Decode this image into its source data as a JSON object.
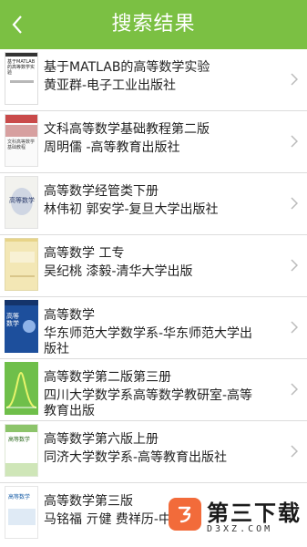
{
  "header": {
    "title": "搜索结果",
    "back_icon": "chevron-left-icon"
  },
  "colors": {
    "header": "#7bc043",
    "text": "#222222",
    "divider": "#dcdcdc",
    "watermark": "#f26b3a"
  },
  "books": [
    {
      "title": "基于MATLAB的高等数学实验",
      "meta": "黄亚群-电子工业出版社",
      "cover_text": "基于MATLAB 的高等数学实验"
    },
    {
      "title": "文科高等数学基础教程第二版",
      "meta": "周明儒 -高等教育出版社",
      "cover_text": "文科高等数学 基础教程"
    },
    {
      "title": "高等数学经管类下册",
      "meta": "林伟初 郭安学-复旦大学出版社",
      "cover_text": "高等数学"
    },
    {
      "title": "高等数学 工专",
      "meta": "吴纪桃 漆毅-清华大学出版",
      "cover_text": ""
    },
    {
      "title": "高等数学",
      "meta": "华东师范大学数学系-华东师范大学出版社",
      "cover_text": "高等 数学"
    },
    {
      "title": "高等数学第二版第三册",
      "meta": "四川大学数学系高等数学教研室-高等教育出版",
      "cover_text": ""
    },
    {
      "title": "高等数学第六版上册",
      "meta": "同济大学数学系-高等教育出版社",
      "cover_text": "高等数学"
    },
    {
      "title": "高等数学第三版",
      "meta": "马铭福 亓健 费祥历-中",
      "cover_text": "高等数学"
    }
  ],
  "watermark": {
    "name": "第三下载",
    "domain": "D3XZ.COM"
  }
}
